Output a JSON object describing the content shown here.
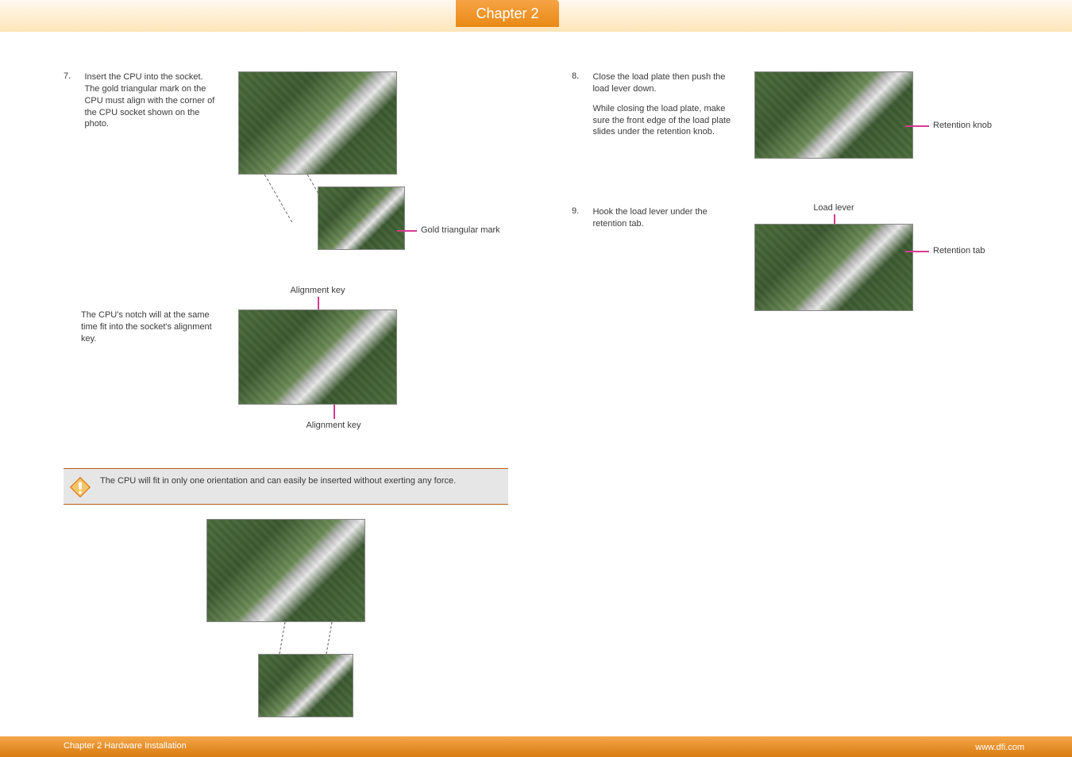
{
  "header": {
    "chapter_tab": "Chapter 2"
  },
  "footer": {
    "left": "Chapter 2 Hardware Installation",
    "right": "www.dfi.com"
  },
  "left": {
    "step7": {
      "num": "7.",
      "text": "Insert the CPU into the socket. The gold triangular mark on the CPU must align with the corner of the CPU socket shown on the photo."
    },
    "callout_gold": "Gold triangular mark",
    "notch_text": "The CPU's notch will at the same time fit into the socket's alignment key.",
    "align_top": "Alignment key",
    "align_bottom": "Alignment key",
    "note": "The CPU will fit in only one orientation and can easily be inserted without exerting any force."
  },
  "right": {
    "step8": {
      "num": "8.",
      "text": "Close the load plate then push the load lever down.",
      "text2": "While closing the load plate, make sure the front edge of the load plate slides under the retention knob."
    },
    "step9": {
      "num": "9.",
      "text": "Hook the load lever under the retention tab."
    },
    "retention_knob": "Retention knob",
    "load_lever": "Load lever",
    "retention_tab": "Retention tab"
  }
}
